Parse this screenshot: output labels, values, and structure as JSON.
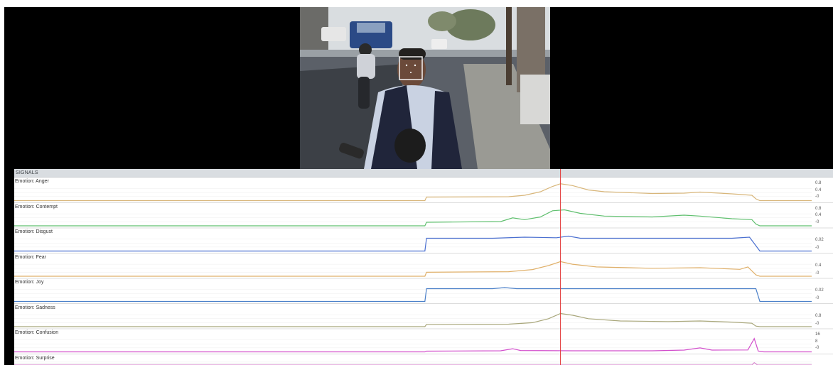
{
  "panel": {
    "title": "SIGNALS"
  },
  "playhead": {
    "time_fraction": 0.685
  },
  "colors": {
    "anger": "#d8b67a",
    "contempt": "#5fbf6e",
    "disgust": "#4a6fd0",
    "fear": "#e0b06a",
    "joy": "#4a7fc8",
    "sadness": "#a8a67a",
    "confusion": "#d24fcc",
    "surprise": "#d98ad0",
    "playhead": "#e23a3a",
    "grid": "#eeeeee"
  },
  "tracks": [
    {
      "label": "Emotion: Anger",
      "color_key": "anger",
      "ticks": [
        "0.8",
        "0.4",
        "-0"
      ],
      "ymax": 0.9,
      "points": [
        [
          0,
          0
        ],
        [
          0.515,
          0
        ],
        [
          0.517,
          0.2
        ],
        [
          0.62,
          0.22
        ],
        [
          0.64,
          0.3
        ],
        [
          0.66,
          0.5
        ],
        [
          0.675,
          0.8
        ],
        [
          0.685,
          0.95
        ],
        [
          0.7,
          0.85
        ],
        [
          0.72,
          0.6
        ],
        [
          0.74,
          0.5
        ],
        [
          0.8,
          0.4
        ],
        [
          0.84,
          0.42
        ],
        [
          0.86,
          0.48
        ],
        [
          0.9,
          0.38
        ],
        [
          0.925,
          0.3
        ],
        [
          0.93,
          0.1
        ],
        [
          0.935,
          0
        ],
        [
          1,
          0
        ]
      ]
    },
    {
      "label": "Emotion: Contempt",
      "color_key": "contempt",
      "ticks": [
        "0.8",
        "0.4",
        "-0"
      ],
      "ymax": 0.9,
      "points": [
        [
          0,
          0
        ],
        [
          0.515,
          0
        ],
        [
          0.517,
          0.2
        ],
        [
          0.61,
          0.24
        ],
        [
          0.625,
          0.45
        ],
        [
          0.64,
          0.35
        ],
        [
          0.66,
          0.5
        ],
        [
          0.675,
          0.85
        ],
        [
          0.69,
          0.9
        ],
        [
          0.71,
          0.7
        ],
        [
          0.74,
          0.55
        ],
        [
          0.8,
          0.5
        ],
        [
          0.84,
          0.6
        ],
        [
          0.86,
          0.55
        ],
        [
          0.9,
          0.4
        ],
        [
          0.925,
          0.35
        ],
        [
          0.93,
          0.1
        ],
        [
          0.935,
          0
        ],
        [
          1,
          0
        ]
      ]
    },
    {
      "label": "Emotion: Disgust",
      "color_key": "disgust",
      "ticks": [
        "0.02",
        "-0"
      ],
      "ymax": 0.03,
      "points": [
        [
          0,
          0
        ],
        [
          0.515,
          0
        ],
        [
          0.517,
          0.024
        ],
        [
          0.6,
          0.024
        ],
        [
          0.64,
          0.026
        ],
        [
          0.68,
          0.025
        ],
        [
          0.695,
          0.028
        ],
        [
          0.71,
          0.024
        ],
        [
          0.8,
          0.024
        ],
        [
          0.9,
          0.024
        ],
        [
          0.922,
          0.026
        ],
        [
          0.93,
          0.01
        ],
        [
          0.935,
          0
        ],
        [
          1,
          0
        ]
      ]
    },
    {
      "label": "Emotion: Fear",
      "color_key": "fear",
      "ticks": [
        "0.4",
        "-0"
      ],
      "ymax": 0.6,
      "points": [
        [
          0,
          0
        ],
        [
          0.515,
          0
        ],
        [
          0.517,
          0.15
        ],
        [
          0.62,
          0.17
        ],
        [
          0.65,
          0.25
        ],
        [
          0.67,
          0.4
        ],
        [
          0.685,
          0.55
        ],
        [
          0.7,
          0.45
        ],
        [
          0.73,
          0.35
        ],
        [
          0.8,
          0.3
        ],
        [
          0.86,
          0.32
        ],
        [
          0.91,
          0.26
        ],
        [
          0.92,
          0.35
        ],
        [
          0.93,
          0.05
        ],
        [
          0.935,
          0
        ],
        [
          1,
          0
        ]
      ]
    },
    {
      "label": "Emotion: Joy",
      "color_key": "joy",
      "ticks": [
        "0.02",
        "-0"
      ],
      "ymax": 0.03,
      "points": [
        [
          0,
          0
        ],
        [
          0.515,
          0
        ],
        [
          0.517,
          0.024
        ],
        [
          0.6,
          0.024
        ],
        [
          0.615,
          0.026
        ],
        [
          0.63,
          0.024
        ],
        [
          0.8,
          0.024
        ],
        [
          0.92,
          0.024
        ],
        [
          0.93,
          0.024
        ],
        [
          0.935,
          0
        ],
        [
          1,
          0
        ]
      ]
    },
    {
      "label": "Emotion: Sadness",
      "color_key": "sadness",
      "ticks": [
        "0.8",
        "-0"
      ],
      "ymax": 1.4,
      "points": [
        [
          0,
          0
        ],
        [
          0.515,
          0
        ],
        [
          0.517,
          0.2
        ],
        [
          0.62,
          0.22
        ],
        [
          0.65,
          0.35
        ],
        [
          0.67,
          0.7
        ],
        [
          0.685,
          1.15
        ],
        [
          0.7,
          1.0
        ],
        [
          0.72,
          0.7
        ],
        [
          0.76,
          0.5
        ],
        [
          0.82,
          0.45
        ],
        [
          0.86,
          0.5
        ],
        [
          0.9,
          0.4
        ],
        [
          0.925,
          0.3
        ],
        [
          0.93,
          0.05
        ],
        [
          0.935,
          0
        ],
        [
          1,
          0
        ]
      ]
    },
    {
      "label": "Emotion: Confusion",
      "color_key": "confusion",
      "ticks": [
        "16",
        "8",
        "-0"
      ],
      "ymax": 18,
      "points": [
        [
          0,
          0
        ],
        [
          0.515,
          0
        ],
        [
          0.517,
          0.8
        ],
        [
          0.61,
          1.2
        ],
        [
          0.625,
          3.5
        ],
        [
          0.635,
          1.5
        ],
        [
          0.7,
          1.2
        ],
        [
          0.8,
          1.2
        ],
        [
          0.84,
          2.0
        ],
        [
          0.86,
          4.5
        ],
        [
          0.875,
          2.0
        ],
        [
          0.92,
          2.2
        ],
        [
          0.928,
          15
        ],
        [
          0.933,
          1
        ],
        [
          0.94,
          0
        ],
        [
          1,
          0
        ]
      ]
    },
    {
      "label": "Emotion: Surprise",
      "color_key": "surprise",
      "ticks": [],
      "ymax": 1,
      "points": [
        [
          0,
          0
        ],
        [
          0.925,
          0
        ],
        [
          0.928,
          0.6
        ],
        [
          0.932,
          0
        ],
        [
          1,
          0
        ]
      ]
    }
  ]
}
